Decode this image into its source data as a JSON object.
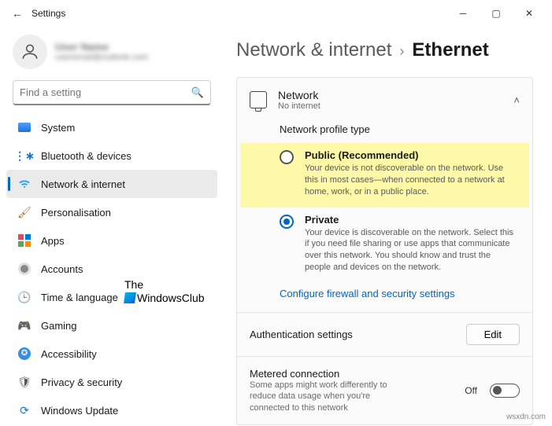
{
  "window": {
    "title": "Settings"
  },
  "user": {
    "name": "User Name",
    "email": "useremail@outlook.com"
  },
  "search": {
    "placeholder": "Find a setting"
  },
  "nav": [
    {
      "label": "System"
    },
    {
      "label": "Bluetooth & devices"
    },
    {
      "label": "Network & internet"
    },
    {
      "label": "Personalisation"
    },
    {
      "label": "Apps"
    },
    {
      "label": "Accounts"
    },
    {
      "label": "Time & language"
    },
    {
      "label": "Gaming"
    },
    {
      "label": "Accessibility"
    },
    {
      "label": "Privacy & security"
    },
    {
      "label": "Windows Update"
    }
  ],
  "breadcrumb": {
    "parent": "Network & internet",
    "current": "Ethernet"
  },
  "network_card": {
    "title": "Network",
    "subtitle": "No internet",
    "section": "Network profile type",
    "options": [
      {
        "title": "Public (Recommended)",
        "desc": "Your device is not discoverable on the network. Use this in most cases—when connected to a network at home, work, or in a public place."
      },
      {
        "title": "Private",
        "desc": "Your device is discoverable on the network. Select this if you need file sharing or use apps that communicate over this network. You should know and trust the people and devices on the network."
      }
    ],
    "link": "Configure firewall and security settings"
  },
  "auth_row": {
    "label": "Authentication settings",
    "button": "Edit"
  },
  "metered_row": {
    "label": "Metered connection",
    "desc": "Some apps might work differently to reduce data usage when you're connected to this network",
    "state": "Off"
  },
  "watermark": {
    "line1": "The",
    "line2": "WindowsClub"
  },
  "credit": "wsxdn.com"
}
